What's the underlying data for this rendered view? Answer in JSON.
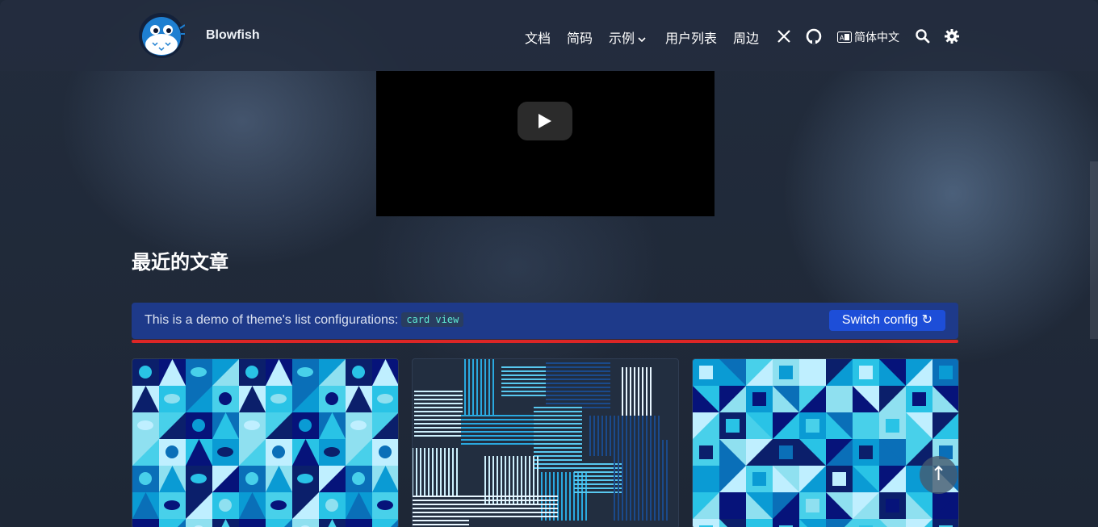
{
  "site": {
    "brand": "Blowfish"
  },
  "nav": {
    "items": [
      {
        "label": "文档"
      },
      {
        "label": "简码"
      },
      {
        "label": "示例"
      },
      {
        "label": "用户列表"
      },
      {
        "label": "周边"
      }
    ],
    "language": "简体中文"
  },
  "main": {
    "section_title": "最近的文章",
    "banner": {
      "text": "This is a demo of theme's list configurations:",
      "code": "card view",
      "switch_label": "Switch config ↻"
    },
    "back_to_top": "↑"
  },
  "colors": {
    "banner_bg": "#1e3a8a",
    "accent_line": "#dc2626",
    "code_text": "#5eead4"
  },
  "icons": [
    "x-icon",
    "github-icon",
    "translate-icon",
    "search-icon",
    "gear-icon",
    "play-icon",
    "chevron-down-icon",
    "refresh-icon"
  ]
}
